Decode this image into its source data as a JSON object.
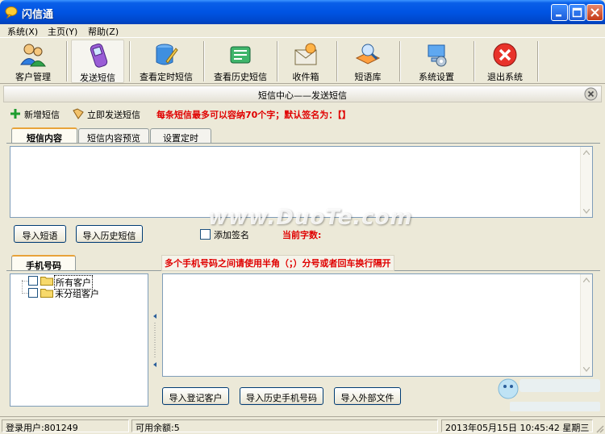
{
  "window": {
    "title": "闪信通"
  },
  "menu": [
    {
      "label": "系统(X)"
    },
    {
      "label": "主页(Y)"
    },
    {
      "label": "帮助(Z)"
    }
  ],
  "toolbar": [
    {
      "label": "客户管理",
      "icon": "users-icon"
    },
    {
      "label": "发送短信",
      "icon": "phone-icon"
    },
    {
      "label": "查看定时短信",
      "icon": "scheduled-sms-icon"
    },
    {
      "label": "查看历史短信",
      "icon": "history-sms-icon"
    },
    {
      "label": "收件箱",
      "icon": "inbox-icon"
    },
    {
      "label": "短语库",
      "icon": "phrase-library-icon"
    },
    {
      "label": "系统设置",
      "icon": "settings-icon"
    },
    {
      "label": "退出系统",
      "icon": "exit-icon"
    }
  ],
  "panel": {
    "title": "短信中心——发送短信"
  },
  "actions": {
    "new_sms": "新增短信",
    "send_now": "立即发送短信",
    "notice": "每条短信最多可以容纳70个字；默认签名为：【】"
  },
  "content_tabs": [
    {
      "label": "短信内容",
      "selected": true
    },
    {
      "label": "短信内容预览",
      "selected": false
    },
    {
      "label": "设置定时",
      "selected": false
    }
  ],
  "message": {
    "value": "",
    "import_phrase": "导入短语",
    "import_history": "导入历史短信",
    "add_signature": "添加签名",
    "char_count_label": "当前字数:"
  },
  "phone_tab": {
    "label": "手机号码"
  },
  "phone_notice": "多个手机号码之间请使用半角（；）分号或者回车换行隔开",
  "tree": [
    {
      "label": "所有客户"
    },
    {
      "label": "未分组客户"
    }
  ],
  "phone_buttons": {
    "import_registered": "导入登记客户",
    "import_history_numbers": "导入历史手机号码",
    "import_external": "导入外部文件"
  },
  "status": {
    "user": "登录用户:801249",
    "balance": "可用余额:5",
    "datetime": "2013年05月15日  10:45:42  星期三"
  },
  "watermark": "www.DuoTe.com",
  "colors": {
    "title_blue": "#0054e3",
    "warn_red": "#e00000",
    "tab_accent": "#e8a33a"
  }
}
